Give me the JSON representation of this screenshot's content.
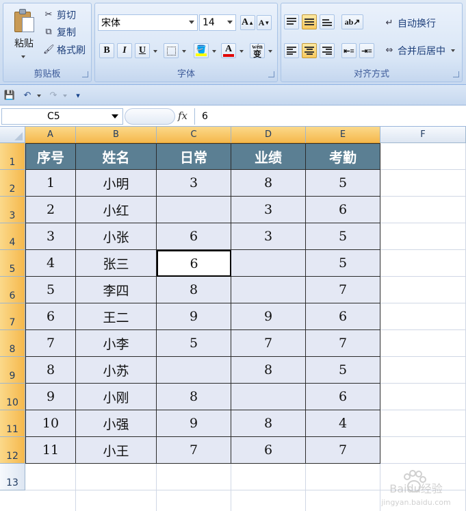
{
  "ribbon": {
    "clipboard": {
      "label": "剪贴板",
      "paste": "粘贴",
      "cut": "剪切",
      "copy": "复制",
      "format_painter": "格式刷"
    },
    "font": {
      "label": "字体",
      "family": "宋体",
      "size": "14",
      "grow_glyph": "A",
      "shrink_glyph": "A",
      "bold": "B",
      "italic": "I",
      "underline": "U",
      "phonetic": "wén"
    },
    "alignment": {
      "label": "对齐方式",
      "wrap_text": "自动换行",
      "merge_center": "合并后居中"
    }
  },
  "name_box": "C5",
  "fx_label": "fx",
  "formula_value": "6",
  "columns": [
    "A",
    "B",
    "C",
    "D",
    "E",
    "F"
  ],
  "rows": [
    "1",
    "2",
    "3",
    "4",
    "5",
    "6",
    "7",
    "8",
    "9",
    "10",
    "11",
    "12",
    "13"
  ],
  "table": {
    "headers": [
      "序号",
      "姓名",
      "日常",
      "业绩",
      "考勤"
    ],
    "rows": [
      [
        "1",
        "小明",
        "3",
        "8",
        "5"
      ],
      [
        "2",
        "小红",
        "",
        "3",
        "6"
      ],
      [
        "3",
        "小张",
        "6",
        "3",
        "5"
      ],
      [
        "4",
        "张三",
        "6",
        "",
        "5"
      ],
      [
        "5",
        "李四",
        "8",
        "",
        "7"
      ],
      [
        "6",
        "王二",
        "9",
        "9",
        "6"
      ],
      [
        "7",
        "小李",
        "5",
        "7",
        "7"
      ],
      [
        "8",
        "小苏",
        "",
        "8",
        "5"
      ],
      [
        "9",
        "小刚",
        "8",
        "",
        "6"
      ],
      [
        "10",
        "小强",
        "9",
        "8",
        "4"
      ],
      [
        "11",
        "小王",
        "7",
        "6",
        "7"
      ]
    ]
  },
  "active_cell": "C5",
  "colors": {
    "header_fill": "#5b7f93",
    "body_fill": "#e4e8f4",
    "selected_header": "#f5b84c"
  },
  "watermark": {
    "brand": "Baidu经验",
    "url": "jingyan.baidu.com"
  }
}
